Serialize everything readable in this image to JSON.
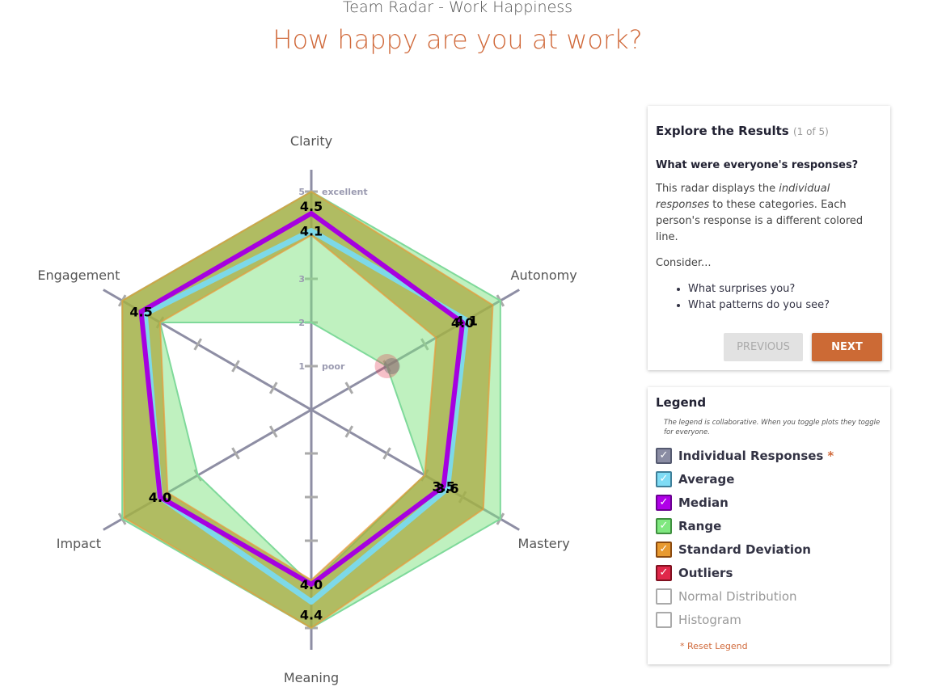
{
  "header": {
    "subtitle": "Team Radar - Work Happiness",
    "title": "How happy are you at work?"
  },
  "chart_data": {
    "type": "radar",
    "categories": [
      "Clarity",
      "Autonomy",
      "Mastery",
      "Meaning",
      "Impact",
      "Engagement"
    ],
    "rlim": [
      0,
      5
    ],
    "scale_labels": [
      {
        "value": 1,
        "tick": "1",
        "label": "poor"
      },
      {
        "value": 2,
        "tick": "2",
        "label": ""
      },
      {
        "value": 3,
        "tick": "3",
        "label": ""
      },
      {
        "value": 4,
        "tick": "4",
        "label": ""
      },
      {
        "value": 5,
        "tick": "5",
        "label": "excellent"
      }
    ],
    "range": {
      "color": "#7fe37f",
      "min": [
        2,
        2,
        3,
        4,
        3,
        4
      ],
      "max": [
        5,
        5,
        5,
        5,
        5,
        5
      ]
    },
    "std_dev": {
      "color": "#e89a3a",
      "low": [
        4,
        3.3,
        3,
        3.9,
        3.8,
        4
      ],
      "high": [
        5,
        4.8,
        4.55,
        5,
        4.95,
        5
      ]
    },
    "average": {
      "color": "#7dd9e8",
      "values": [
        4.1,
        4.1,
        3.6,
        4.4,
        4.0,
        4.4
      ],
      "labels": [
        "4.1",
        "4.1",
        "3.6",
        "4.4",
        "4.0",
        ""
      ]
    },
    "median": {
      "color": "#a600e0",
      "values": [
        4.5,
        4.0,
        3.5,
        4.0,
        4.0,
        4.5
      ],
      "labels": [
        "4.5",
        "4.0",
        "3.5",
        "4.0",
        "4.0",
        "4.5"
      ]
    },
    "outliers": [
      {
        "category": "Autonomy",
        "value": 2,
        "color": "#e0304a"
      }
    ]
  },
  "explore": {
    "title": "Explore the Results",
    "count": "(1 of 5)",
    "question": "What were everyone's responses?",
    "text_a": "This radar displays the ",
    "text_em": "individual responses",
    "text_b": " to these categories. Each person's response is a different colored line.",
    "consider": "Consider...",
    "bullets": [
      "What surprises you?",
      "What patterns do you see?"
    ],
    "previous": "PREVIOUS",
    "next": "NEXT"
  },
  "legend": {
    "title": "Legend",
    "note": "The legend is collaborative. When you toggle plots they toggle for everyone.",
    "items": [
      {
        "label": "Individual Responses",
        "checked": true,
        "color": "#8a8ca3",
        "border": "#555a70",
        "star": "*"
      },
      {
        "label": "Average",
        "checked": true,
        "color": "#7fdcf5",
        "border": "#3f7f99"
      },
      {
        "label": "Median",
        "checked": true,
        "color": "#b000e8",
        "border": "#6a0090"
      },
      {
        "label": "Range",
        "checked": true,
        "color": "#7fe87f",
        "border": "#3f8f3f"
      },
      {
        "label": "Standard Deviation",
        "checked": true,
        "color": "#e89a30",
        "border": "#8a4a10"
      },
      {
        "label": "Outliers",
        "checked": true,
        "color": "#e0284a",
        "border": "#80101f"
      },
      {
        "label": "Normal Distribution",
        "checked": false
      },
      {
        "label": "Histogram",
        "checked": false
      }
    ],
    "reset": "* Reset Legend"
  }
}
